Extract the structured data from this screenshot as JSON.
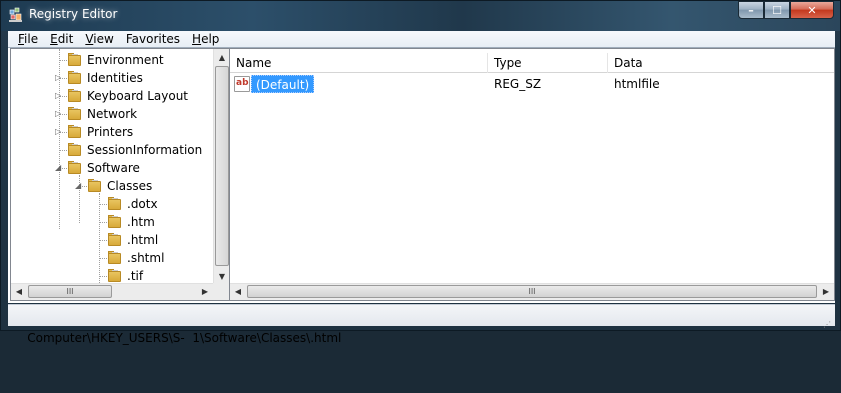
{
  "window": {
    "title": "Registry Editor",
    "controls": {
      "minimize": "–",
      "maximize": "☐",
      "close": "✕"
    }
  },
  "menu": [
    {
      "underline": "F",
      "rest": "ile"
    },
    {
      "underline": "E",
      "rest": "dit"
    },
    {
      "underline": "V",
      "rest": "iew"
    },
    {
      "underline": "F",
      "rest": "avorites",
      "prefix": "",
      "full": "Favorites"
    },
    {
      "underline": "H",
      "rest": "elp"
    }
  ],
  "tree": {
    "items": [
      {
        "label": "Environment",
        "expander": ""
      },
      {
        "label": "Identities",
        "expander": "▷"
      },
      {
        "label": "Keyboard Layout",
        "expander": "▷"
      },
      {
        "label": "Network",
        "expander": "▷"
      },
      {
        "label": "Printers",
        "expander": "▷"
      },
      {
        "label": "SessionInformation",
        "expander": ""
      },
      {
        "label": "Software",
        "expander": "◢"
      },
      {
        "label": "Classes",
        "expander": "◢"
      },
      {
        "label": ".dotx",
        "expander": ""
      },
      {
        "label": ".htm",
        "expander": ""
      },
      {
        "label": ".html",
        "expander": ""
      },
      {
        "label": ".shtml",
        "expander": ""
      },
      {
        "label": ".tif",
        "expander": ""
      }
    ],
    "scroll_grip": "III"
  },
  "list": {
    "columns": [
      "Name",
      "Type",
      "Data"
    ],
    "rows": [
      {
        "icon": "ab",
        "name": "(Default)",
        "type": "REG_SZ",
        "data": "htmlfile",
        "selected": true
      }
    ],
    "scroll_grip": "III"
  },
  "statusbar": {
    "path": "Computer\\HKEY_USERS\\S-  1\\Software\\Classes\\.html"
  },
  "colors": {
    "selection": "#3399ff",
    "folder": "#e0b84d",
    "window_frame": "#23394a"
  }
}
